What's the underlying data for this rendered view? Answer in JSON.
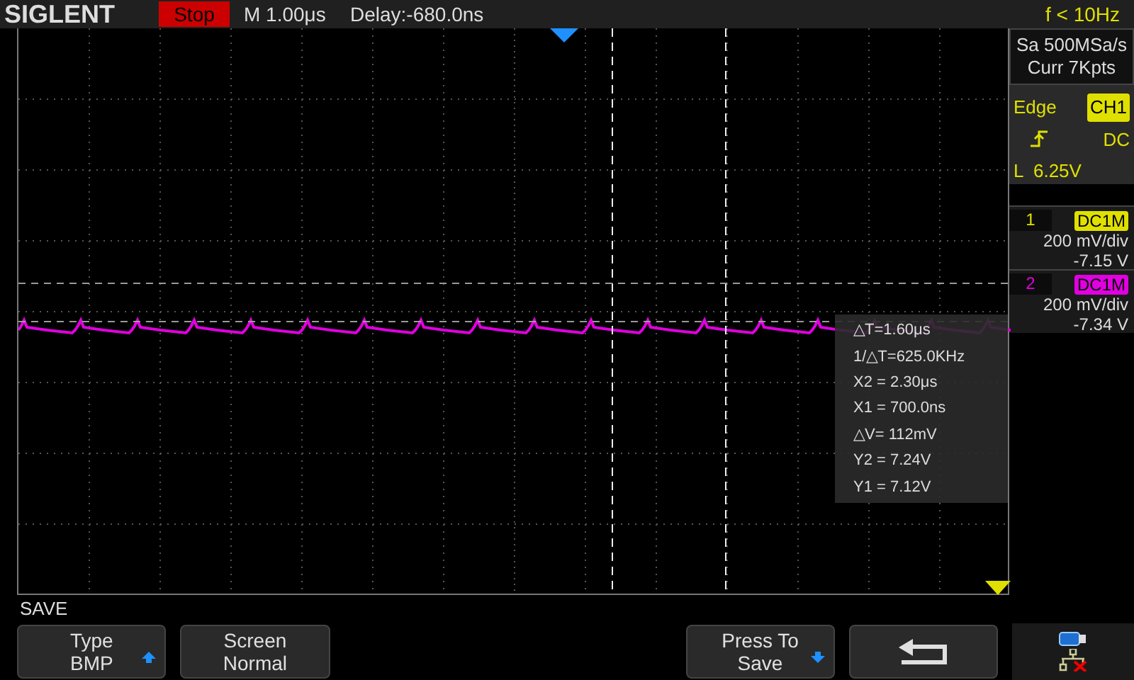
{
  "brand": "SIGLENT",
  "run_state": {
    "label": "Stop",
    "stopped": true
  },
  "timebase": "M 1.00μs",
  "delay": "Delay:-680.0ns",
  "frequency": "f < 10Hz",
  "acquisition": {
    "sample_rate": "Sa 500MSa/s",
    "memory": "Curr 7Kpts"
  },
  "trigger": {
    "type": "Edge",
    "source": "CH1",
    "coupling": "DC",
    "level": "L  6.25V",
    "color": "#e0e000"
  },
  "channels": [
    {
      "number": "1",
      "coupling": "DC1M",
      "scale": "200 mV/div",
      "offset": "-7.15 V",
      "color": "#e0e000"
    },
    {
      "number": "2",
      "coupling": "DC1M",
      "scale": "200 mV/div",
      "offset": "-7.34 V",
      "color": "#e000e0"
    }
  ],
  "measurements": [
    "△T=1.60μs",
    "1/△T=625.0KHz",
    "X2 = 2.30μs",
    "X1 = 700.0ns",
    "△V= 112mV",
    "Y2 = 7.24V",
    "Y1 = 7.12V"
  ],
  "menu": {
    "title": "SAVE",
    "buttons": [
      {
        "kind": "cycle",
        "label": "Type",
        "value": "BMP"
      },
      {
        "kind": "plain",
        "label": "Screen",
        "value": "Normal"
      },
      {
        "kind": "spacer"
      },
      {
        "kind": "action",
        "label": "Press To",
        "value": "Save"
      },
      {
        "kind": "back"
      }
    ]
  }
}
